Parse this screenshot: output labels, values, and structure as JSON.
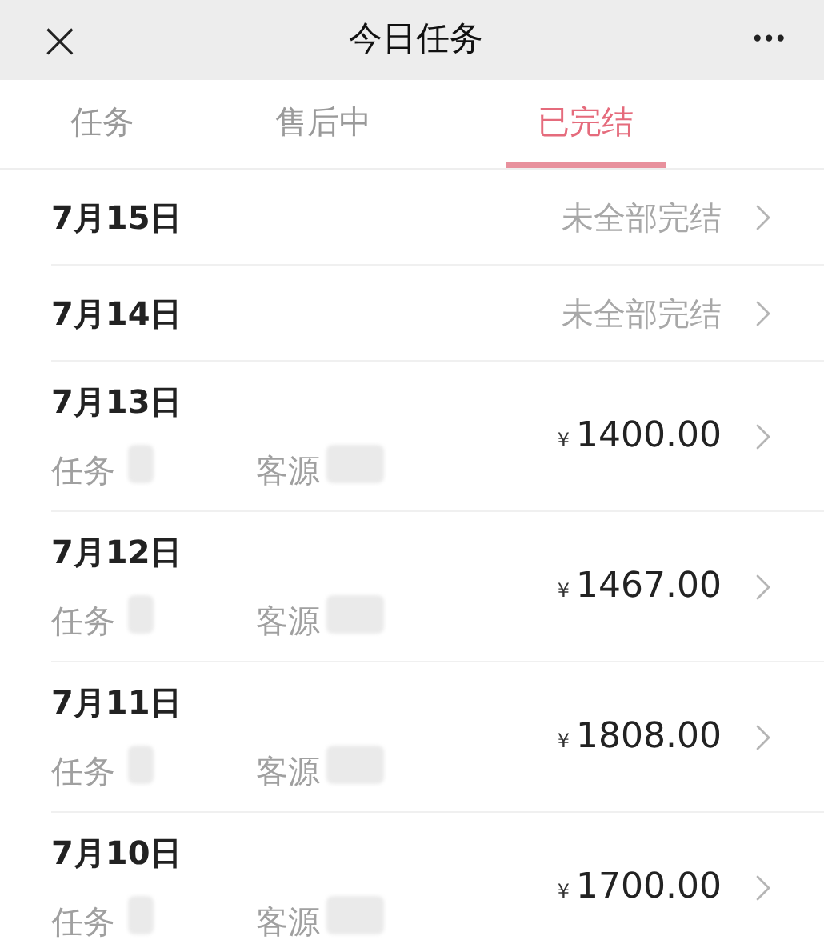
{
  "header": {
    "close": "×",
    "title": "今日任务",
    "more": "•••"
  },
  "tabs": [
    {
      "label": "任务",
      "selected": false
    },
    {
      "label": "售后中",
      "selected": false
    },
    {
      "label": "已完结",
      "selected": true
    }
  ],
  "rows": [
    {
      "kind": "summary",
      "date": "7月15日",
      "status": "未全部完结"
    },
    {
      "kind": "summary",
      "date": "7月14日",
      "status": "未全部完结"
    },
    {
      "kind": "detail",
      "date": "7月13日",
      "task_label": "任务",
      "source_label": "客源",
      "currency": "¥",
      "amount": "1400.00"
    },
    {
      "kind": "detail",
      "date": "7月12日",
      "task_label": "任务",
      "source_label": "客源",
      "currency": "¥",
      "amount": "1467.00"
    },
    {
      "kind": "detail",
      "date": "7月11日",
      "task_label": "任务",
      "source_label": "客源",
      "currency": "¥",
      "amount": "1808.00"
    },
    {
      "kind": "detail",
      "date": "7月10日",
      "task_label": "任务",
      "source_label": "客源",
      "currency": "¥",
      "amount": "1700.00"
    }
  ]
}
